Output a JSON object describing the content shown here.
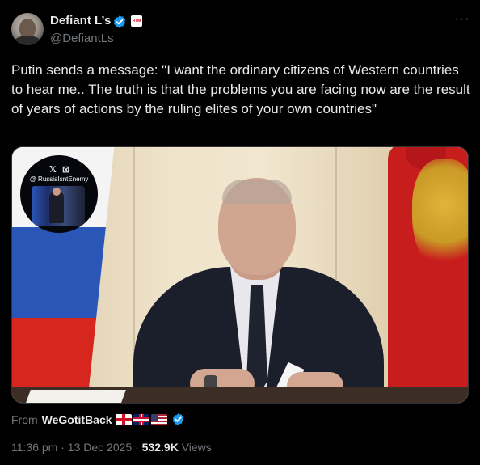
{
  "author": {
    "display_name": "Defiant L’s",
    "handle": "@DefiantLs",
    "affiliate_badge_text": "RTM",
    "verified_icon": "verified-badge-icon"
  },
  "menu": {
    "more_label": "···"
  },
  "tweet": {
    "text": "Putin sends a message: \"I want the ordinary citizens of Western countries to hear me.. The truth is that the problems you are facing now are the result of years of actions by the ruling elites of your own countries\""
  },
  "media": {
    "watermark_icons": "𝕏 ⊠",
    "watermark_text": "@ RussiaIsntEnemy"
  },
  "source": {
    "prefix": "From",
    "name": "WeGotitBack",
    "flags": [
      "england-flag-icon",
      "uk-flag-icon",
      "us-flag-icon"
    ]
  },
  "meta": {
    "time": "11:36 pm",
    "sep1": " · ",
    "date": "13 Dec 2025",
    "sep2": " · ",
    "views_count": "532.9K",
    "views_label": " Views"
  },
  "colors": {
    "background": "#000000",
    "text": "#e7e9ea",
    "muted": "#71767b",
    "verified": "#1d9bf0"
  }
}
